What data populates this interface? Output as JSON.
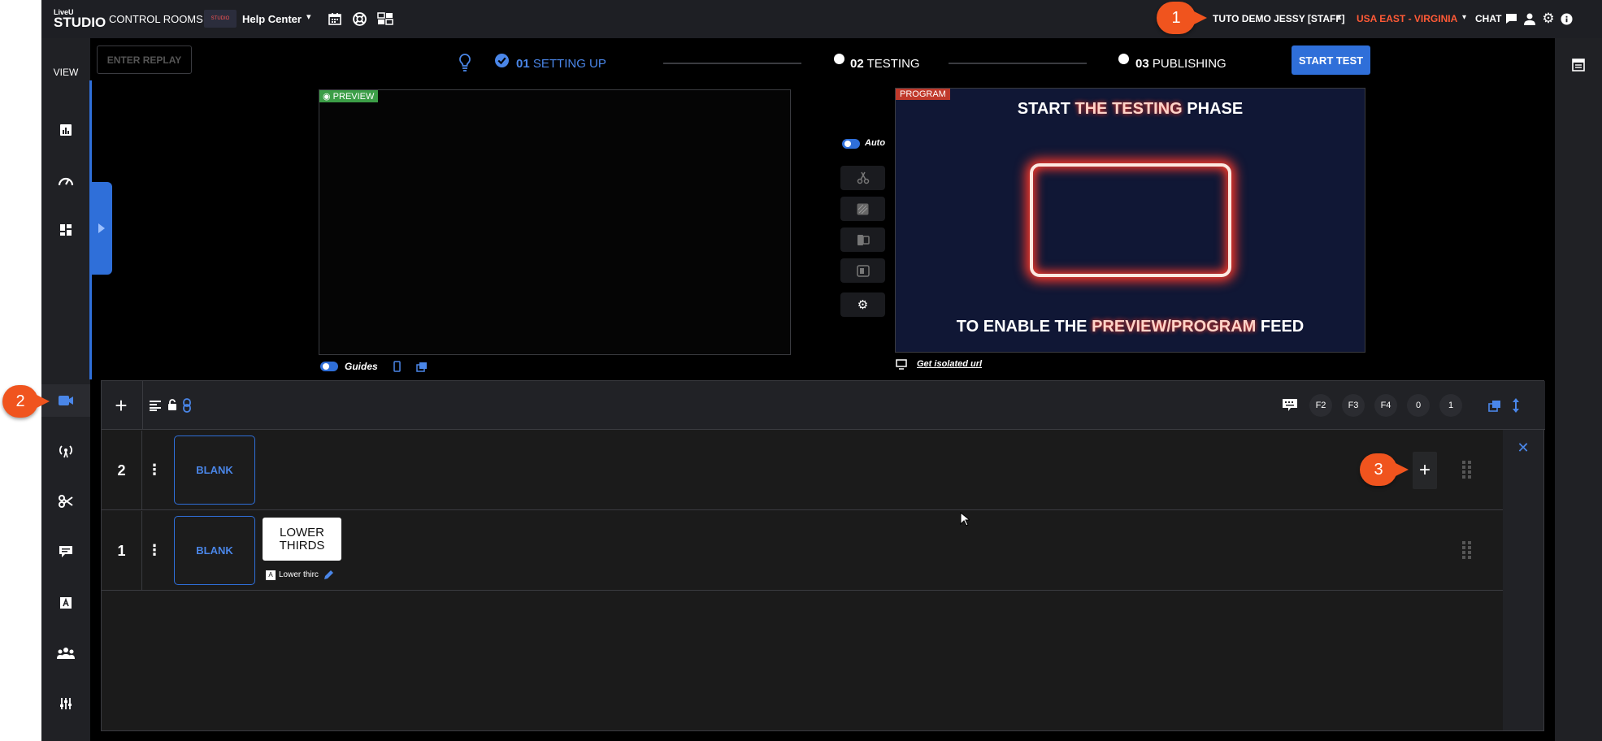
{
  "topbar": {
    "logo_top": "LiveU",
    "logo_main": "STUDIO",
    "control_rooms": "CONTROL ROOMS",
    "help_center_thumb": "STUDIO",
    "help_center": "Help Center",
    "account": "TUTO DEMO JESSY [STAFF]",
    "region": "USA EAST - VIRGINIA",
    "chat": "CHAT"
  },
  "rail": {
    "view_label": "VIEW"
  },
  "main": {
    "enter_replay": "ENTER REPLAY",
    "steps": [
      {
        "num": "01",
        "label": "SETTING UP"
      },
      {
        "num": "02",
        "label": "TESTING"
      },
      {
        "num": "03",
        "label": "PUBLISHING"
      }
    ],
    "start_test": "START TEST",
    "preview_tag": "PREVIEW",
    "program_tag": "PROGRAM",
    "program_text": {
      "line1_a": "START ",
      "line1_b": "THE TESTING",
      "line1_c": " PHASE",
      "line2_a": "TO ENABLE THE ",
      "line2_b": "PREVIEW/PROGRAM",
      "line2_c": " FEED"
    },
    "auto_label": "Auto",
    "guides_label": "Guides",
    "isolated_url": "Get isolated url"
  },
  "panel": {
    "chips": [
      "F2",
      "F3",
      "F4",
      "0",
      "1"
    ],
    "rows": [
      {
        "num": "2",
        "blank": "BLANK"
      },
      {
        "num": "1",
        "blank": "BLANK",
        "lower_thirds": "LOWER THIRDS",
        "lower_thirds_caption": "Lower thirc"
      }
    ]
  },
  "callouts": [
    "1",
    "2",
    "3"
  ],
  "colors": {
    "accent": "#2f6fd9",
    "callout": "#f0541e",
    "region": "#ff5a36",
    "preview": "#3c9e47",
    "program": "#c0392b"
  }
}
